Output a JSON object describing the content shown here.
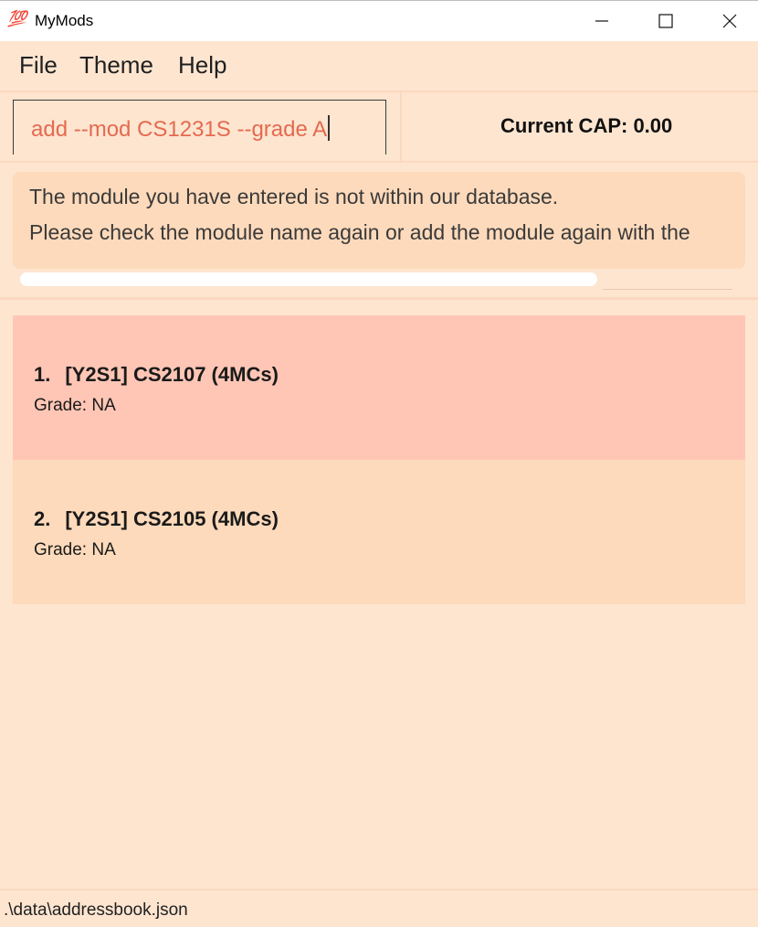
{
  "window": {
    "icon": "💯",
    "icon_name": "hundred-points-icon",
    "title": "MyMods"
  },
  "menu": {
    "file": "File",
    "theme": "Theme",
    "help": "Help"
  },
  "command": {
    "value": "add --mod CS1231S --grade A"
  },
  "cap": {
    "label": "Current CAP: 0.00"
  },
  "result": {
    "lines": [
      "The module you have entered is not within our database.",
      "Please check the module name again or add the module again with the"
    ]
  },
  "modules": [
    {
      "index": "1.",
      "title": "[Y2S1] CS2107 (4MCs)",
      "grade": "Grade: NA"
    },
    {
      "index": "2.",
      "title": "[Y2S1] CS2105 (4MCs)",
      "grade": "Grade: NA"
    }
  ],
  "status": {
    "path": ".\\data\\addressbook.json"
  },
  "colors": {
    "background": "#FEE5D0",
    "card_selected": "#FFC6B5",
    "card": "#FDDABB",
    "command_text": "#e46a4f"
  }
}
